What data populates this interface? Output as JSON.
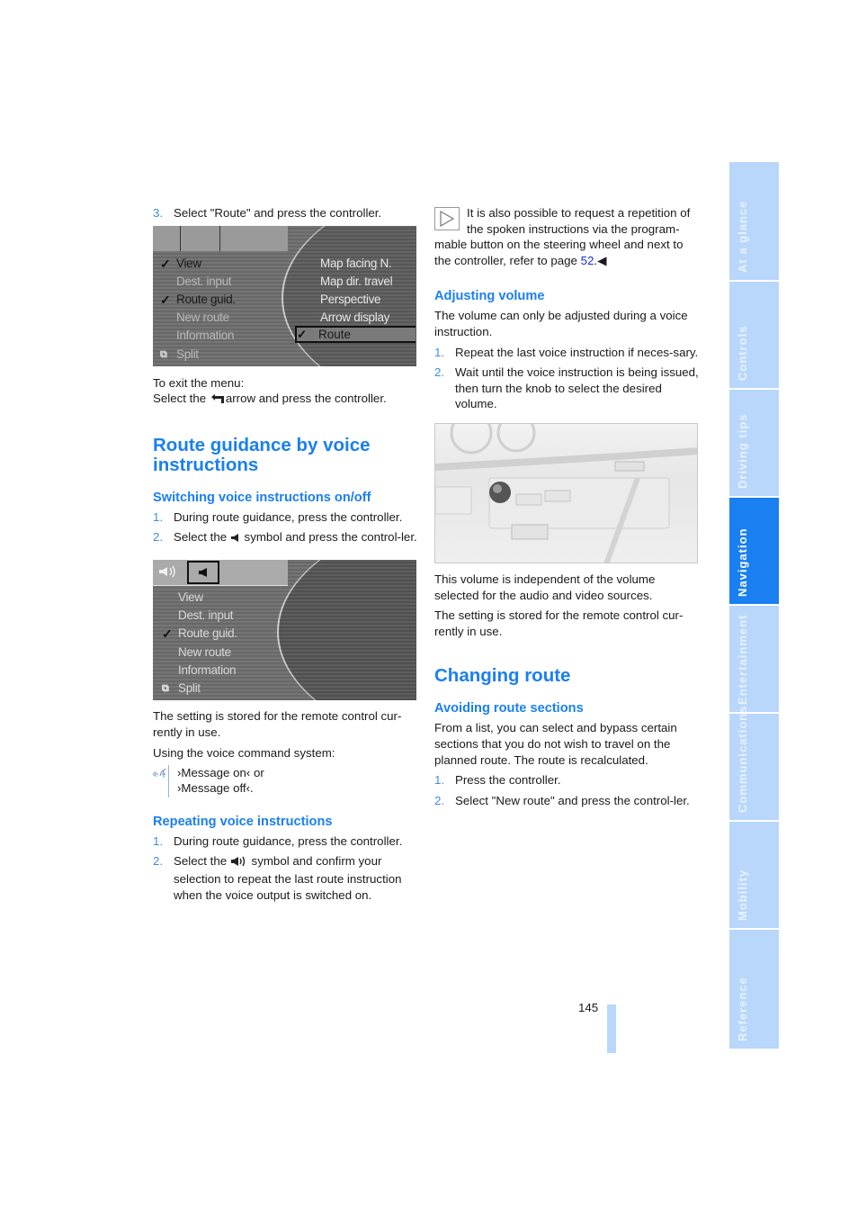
{
  "left_column": {
    "step3": {
      "num": "3.",
      "text": "Select \"Route\" and press the controller."
    },
    "screen1": {
      "menu_items": [
        {
          "label": "View",
          "checked": true
        },
        {
          "label": "Dest. input",
          "checked": false
        },
        {
          "label": "Route guid.",
          "checked": true
        },
        {
          "label": "New route",
          "checked": false
        },
        {
          "label": "Information",
          "checked": false
        },
        {
          "label": "Split",
          "checked": false
        }
      ],
      "submenu_items": [
        "Map facing N.",
        "Map dir. travel",
        "Perspective",
        "Arrow display"
      ],
      "selected_item": {
        "label": "Route",
        "checked": true
      },
      "check_glyph": "✓"
    },
    "exit_menu": {
      "line1": "To exit the menu:",
      "line2_before": "Select the",
      "line2_after": "arrow and press the controller.",
      "icon": "back-arrow-icon"
    },
    "section_title": "Route guidance by voice instructions",
    "switching": {
      "title": "Switching voice instructions on/off",
      "steps": [
        {
          "num": "1.",
          "text": "During route guidance, press the controller."
        },
        {
          "num": "2.",
          "before": "Select the",
          "after": "symbol and press the control-ler.",
          "icon": "speaker-mute-icon"
        }
      ]
    },
    "screen2": {
      "menu_items": [
        {
          "label": "View",
          "checked": false
        },
        {
          "label": "Dest. input",
          "checked": false
        },
        {
          "label": "Route guid.",
          "checked": true
        },
        {
          "label": "New route",
          "checked": false
        },
        {
          "label": "Information",
          "checked": false
        },
        {
          "label": "Split",
          "checked": false
        }
      ]
    },
    "setting_stored": "The setting is stored for the remote control cur-rently in use.",
    "voice_cmd_intro": "Using the voice command system:",
    "voice_commands": [
      "›Message on‹ or",
      "›Message off‹."
    ],
    "repeating": {
      "title": "Repeating voice instructions",
      "steps": [
        {
          "num": "1.",
          "text": "During route guidance, press the controller."
        },
        {
          "num": "2.",
          "before": "Select the",
          "after": "symbol and confirm your selection to repeat the last route instruction when the voice output is switched on.",
          "icon": "speaker-on-icon"
        }
      ]
    }
  },
  "right_column": {
    "note": {
      "text_before": "It is also possible to request a repetition of the spoken instructions via the program-mable button on the steering wheel and next to the controller, refer to page",
      "page_link": "52",
      "end_mark": ".◀"
    },
    "adjusting": {
      "title": "Adjusting volume",
      "intro": "The volume can only be adjusted during a voice instruction.",
      "steps": [
        {
          "num": "1.",
          "text": "Repeat the last voice instruction if neces-sary."
        },
        {
          "num": "2.",
          "text": "Wait until the voice instruction is being issued, then turn the knob to select the desired volume."
        }
      ]
    },
    "after_photo": [
      "This volume is independent of the volume selected for the audio and video sources.",
      "The setting is stored for the remote control cur-rently in use."
    ],
    "changing_title": "Changing route",
    "avoiding": {
      "title": "Avoiding route sections",
      "intro": "From a list, you can select and bypass certain sections that you do not wish to travel on the planned route. The route is recalculated.",
      "steps": [
        {
          "num": "1.",
          "text": "Press the controller."
        },
        {
          "num": "2.",
          "text": "Select \"New route\" and press the control-ler."
        }
      ]
    }
  },
  "side_tabs": [
    {
      "label": "At a glance",
      "active": false
    },
    {
      "label": "Controls",
      "active": false
    },
    {
      "label": "Driving tips",
      "active": false
    },
    {
      "label": "Navigation",
      "active": true
    },
    {
      "label": "Entertainment",
      "active": false
    },
    {
      "label": "Communications",
      "active": false
    },
    {
      "label": "Mobility",
      "active": false
    },
    {
      "label": "Reference",
      "active": false
    }
  ],
  "page_number": "145",
  "colors": {
    "accent": "#1a7ff0",
    "tab_inactive": "#b8d7fb",
    "link": "#1a2bd9"
  }
}
